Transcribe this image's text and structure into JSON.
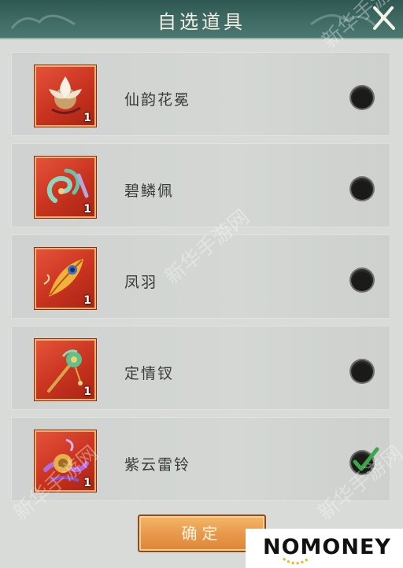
{
  "header": {
    "title": "自选道具"
  },
  "items": [
    {
      "name": "仙韵花冕",
      "quantity": "1",
      "icon": "lotus-crown-icon",
      "selected": false
    },
    {
      "name": "碧鳞佩",
      "quantity": "1",
      "icon": "jade-pendant-icon",
      "selected": false
    },
    {
      "name": "凤羽",
      "quantity": "1",
      "icon": "phoenix-feather-icon",
      "selected": false
    },
    {
      "name": "定情钗",
      "quantity": "1",
      "icon": "hairpin-icon",
      "selected": false
    },
    {
      "name": "紫云雷铃",
      "quantity": "1",
      "icon": "thunder-bell-icon",
      "selected": true
    }
  ],
  "footer": {
    "confirm_label": "确定"
  },
  "watermark": {
    "text": "新华手游网"
  },
  "brand": {
    "text": "NOMONEY"
  },
  "colors": {
    "item_frame": "#d4412a",
    "confirm_button": "#e8974a",
    "check": "#3aa84a",
    "header": "#3f6b64"
  }
}
